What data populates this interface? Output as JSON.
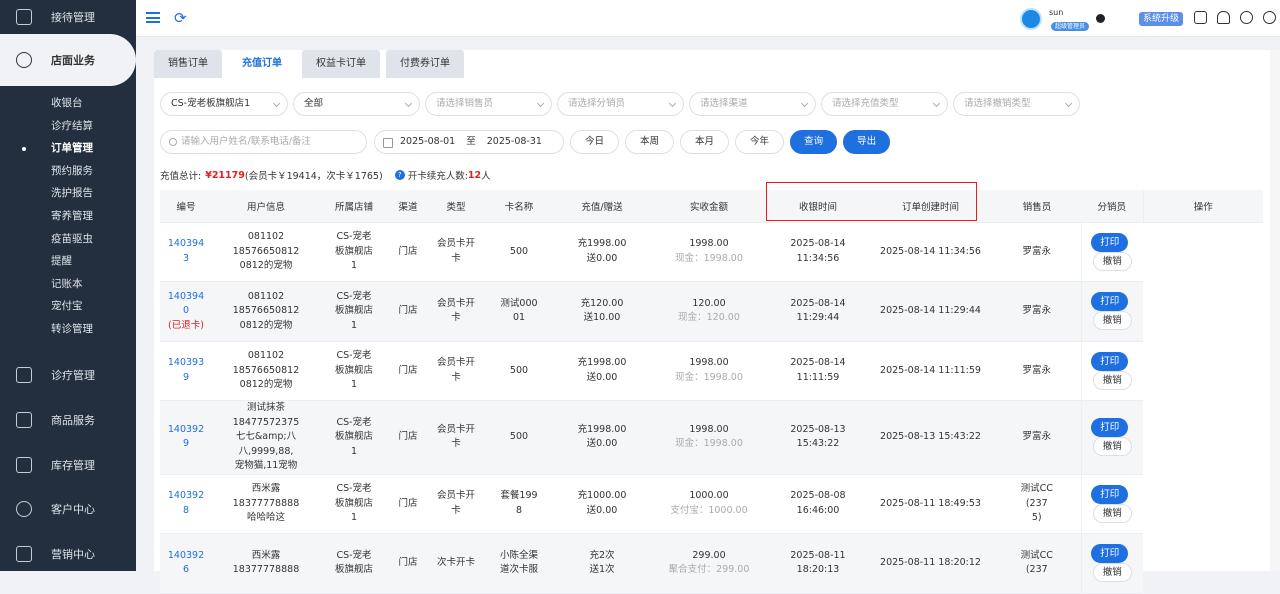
{
  "sidebar": {
    "top_item": "接待管理",
    "active_group": "店面业务",
    "sub_items": [
      "收银台",
      "诊疗结算",
      "订单管理",
      "预约服务",
      "洗护报告",
      "寄养管理",
      "疫苗驱虫",
      "提醒",
      "记账本",
      "宠付宝",
      "转诊管理"
    ],
    "current_sub": "订单管理",
    "groups": [
      "诊疗管理",
      "商品服务",
      "库存管理",
      "客户中心",
      "营销中心"
    ]
  },
  "topbar": {
    "user_name": "sun",
    "user_role": "超级管理员",
    "upgrade_label": "系统升级"
  },
  "tabs": [
    "销售订单",
    "充值订单",
    "权益卡订单",
    "付费券订单"
  ],
  "active_tab": "充值订单",
  "filters": {
    "store": "CS-宠老板旗舰店1",
    "status": "全部",
    "seller_ph": "请选择销售员",
    "distributor_ph": "请选择分销员",
    "channel_ph": "请选择渠道",
    "recharge_type_ph": "请选择充值类型",
    "cancel_type_ph": "请选择撤销类型",
    "search_ph": "请输入用户姓名/联系电话/备注",
    "date_from": "2025-08-01",
    "date_sep": "至",
    "date_to": "2025-08-31",
    "btn_today": "今日",
    "btn_week": "本周",
    "btn_month": "本月",
    "btn_year": "今年",
    "btn_query": "查询",
    "btn_export": "导出"
  },
  "summary": {
    "label": "充值总计:",
    "total": "¥21179",
    "detail": "(会员卡￥19414，次卡￥1765)",
    "cards_label": "开卡续充人数:",
    "cards_count": "12",
    "cards_unit": "人"
  },
  "table": {
    "columns": [
      "编号",
      "用户信息",
      "所属店铺",
      "渠道",
      "类型",
      "卡名称",
      "充值/赠送",
      "实收金额",
      "收银时间",
      "订单创建时间",
      "销售员",
      "分销员",
      "操作"
    ],
    "rows": [
      {
        "id1": "140394",
        "id2": "3",
        "status": "",
        "u1": "081102",
        "u2": "18576650812",
        "u3": "0812的宠物",
        "s1": "CS-宠老",
        "s2": "板旗舰店",
        "s3": "1",
        "channel": "门店",
        "t1": "会员卡开",
        "t2": "卡",
        "card1": "500",
        "card2": "",
        "r1": "充1998.00",
        "r2": "送0.00",
        "amt": "1998.00",
        "pay": "现金：1998.00",
        "c1": "2025-08-14",
        "c2": "11:34:56",
        "created": "2025-08-14 11:34:56",
        "seller1": "罗富永",
        "seller2": "",
        "seller3": "",
        "dist": ""
      },
      {
        "id1": "140394",
        "id2": "0",
        "status": "(已退卡)",
        "u1": "081102",
        "u2": "18576650812",
        "u3": "0812的宠物",
        "s1": "CS-宠老",
        "s2": "板旗舰店",
        "s3": "1",
        "channel": "门店",
        "t1": "会员卡开",
        "t2": "卡",
        "card1": "测试000",
        "card2": "01",
        "r1": "充120.00",
        "r2": "送10.00",
        "amt": "120.00",
        "pay": "现金：120.00",
        "c1": "2025-08-14",
        "c2": "11:29:44",
        "created": "2025-08-14 11:29:44",
        "seller1": "罗富永",
        "seller2": "",
        "seller3": "",
        "dist": ""
      },
      {
        "id1": "140393",
        "id2": "9",
        "status": "",
        "u1": "081102",
        "u2": "18576650812",
        "u3": "0812的宠物",
        "s1": "CS-宠老",
        "s2": "板旗舰店",
        "s3": "1",
        "channel": "门店",
        "t1": "会员卡开",
        "t2": "卡",
        "card1": "500",
        "card2": "",
        "r1": "充1998.00",
        "r2": "送0.00",
        "amt": "1998.00",
        "pay": "现金：1998.00",
        "c1": "2025-08-14",
        "c2": "11:11:59",
        "created": "2025-08-14 11:11:59",
        "seller1": "罗富永",
        "seller2": "",
        "seller3": "",
        "dist": ""
      },
      {
        "id1": "140392",
        "id2": "9",
        "status": "",
        "u1": "测试抹茶",
        "u2": "18477572375",
        "u3": "七七&amp;八八,9999,88,",
        "u4": "宠物猫,11宠物",
        "s1": "CS-宠老",
        "s2": "板旗舰店",
        "s3": "1",
        "channel": "门店",
        "t1": "会员卡开",
        "t2": "卡",
        "card1": "500",
        "card2": "",
        "r1": "充1998.00",
        "r2": "送0.00",
        "amt": "1998.00",
        "pay": "现金：1998.00",
        "c1": "2025-08-13",
        "c2": "15:43:22",
        "created": "2025-08-13 15:43:22",
        "seller1": "罗富永",
        "seller2": "",
        "seller3": "",
        "dist": ""
      },
      {
        "id1": "140392",
        "id2": "8",
        "status": "",
        "u1": "西米露",
        "u2": "18377778888",
        "u3": "哈哈哈这",
        "s1": "CS-宠老",
        "s2": "板旗舰店",
        "s3": "1",
        "channel": "门店",
        "t1": "会员卡开",
        "t2": "卡",
        "card1": "套餐199",
        "card2": "8",
        "r1": "充1000.00",
        "r2": "送0.00",
        "amt": "1000.00",
        "pay": "支付宝：1000.00",
        "c1": "2025-08-08",
        "c2": "16:46:00",
        "created": "2025-08-11 18:49:53",
        "seller1": "测试CC",
        "seller2": "(237",
        "seller3": "5)",
        "dist": ""
      },
      {
        "id1": "140392",
        "id2": "6",
        "status": "",
        "u1": "西米露",
        "u2": "18377778888",
        "u3": "",
        "s1": "CS-宠老",
        "s2": "板旗舰店",
        "s3": "",
        "channel": "门店",
        "t1": "次卡开卡",
        "t2": "",
        "card1": "小陈全渠",
        "card2": "道次卡服",
        "r1": "充2次",
        "r2": "送1次",
        "amt": "299.00",
        "pay": "聚合支付：299.00",
        "c1": "2025-08-11",
        "c2": "18:20:13",
        "created": "2025-08-11 18:20:12",
        "seller1": "测试CC",
        "seller2": "(237",
        "seller3": "",
        "dist": ""
      }
    ],
    "print_label": "打印",
    "cancel_label": "撤销"
  }
}
